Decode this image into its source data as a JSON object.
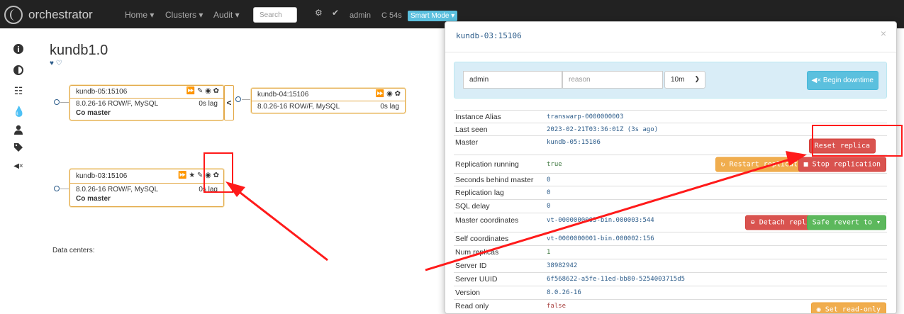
{
  "navbar": {
    "brand": "orchestrator",
    "menu": [
      {
        "label": "Home ▾"
      },
      {
        "label": "Clusters ▾"
      },
      {
        "label": "Audit ▾"
      }
    ],
    "search_placeholder": "Search",
    "icons": [
      "gear-icon",
      "check-circle-icon"
    ],
    "user": "admin",
    "refresh": "C 54s",
    "mode": "Smart Mode ▾"
  },
  "sidebar": {
    "icons": [
      "info-icon",
      "contrast-icon",
      "list-icon",
      "drop-icon",
      "user-icon",
      "tag-icon",
      "mute-icon"
    ]
  },
  "cluster": {
    "name": "kundb1.0",
    "hearts": "♥     ♡"
  },
  "nodes": [
    {
      "name": "kundb-05:15106",
      "icons": "⏩ ✎ ◉ ✿",
      "version": "8.0.26-16 ROW/F, MySQL",
      "lag": "0s lag",
      "role": "Co master"
    },
    {
      "name": "kundb-04:15106",
      "icons": "⏩ ◉ ✿",
      "version": "8.0.26-16 ROW/F, MySQL",
      "lag": "0s lag"
    },
    {
      "name": "kundb-03:15106",
      "icons": "⏩ ★ ✎ ◉ ✿",
      "version": "8.0.26-16 ROW/F, MySQL",
      "lag": "0s lag",
      "role": "Co master"
    }
  ],
  "datacenters_label": "Data centers:",
  "modal": {
    "title": "kundb-03:15106",
    "close": "×",
    "downtime": {
      "owner": "admin",
      "reason_placeholder": "reason",
      "duration": "10m",
      "begin_label": "Begin downtime"
    },
    "rows": [
      {
        "label": "Instance Alias",
        "value": "transwarp-0000000003"
      },
      {
        "label": "Last seen",
        "value": "2023-02-21T03:36:01Z (3s ago)"
      },
      {
        "label": "Master",
        "value": "kundb-05:15106"
      },
      {
        "label": "Replication running",
        "value": "true"
      },
      {
        "label": "Seconds behind master",
        "value": "0"
      },
      {
        "label": "Replication lag",
        "value": "0"
      },
      {
        "label": "SQL delay",
        "value": "0"
      },
      {
        "label": "Master coordinates",
        "value": "vt-0000000003-bin.000003:544"
      },
      {
        "label": "Self coordinates",
        "value": "vt-0000000001-bin.000002:156"
      },
      {
        "label": "Num replicas",
        "value": "1"
      },
      {
        "label": "Server ID",
        "value": "38982942"
      },
      {
        "label": "Server UUID",
        "value": "6f568622-a5fe-11ed-bb80-5254003715d5"
      },
      {
        "label": "Version",
        "value": "8.0.26-16"
      },
      {
        "label": "Read only",
        "value": "false"
      }
    ],
    "buttons": {
      "reset_replica": "Reset replica",
      "restart_replication": "Restart replication",
      "stop_replication": "Stop replication",
      "detach_replica": "Detach replica",
      "safe_revert": "Safe revert to ▾",
      "set_read_only": "Set read-only"
    }
  },
  "colors": {
    "navbar": "#222222",
    "node_border": "#e3a846",
    "annotation": "#ff1a1a",
    "link": "#2c5c8a"
  }
}
